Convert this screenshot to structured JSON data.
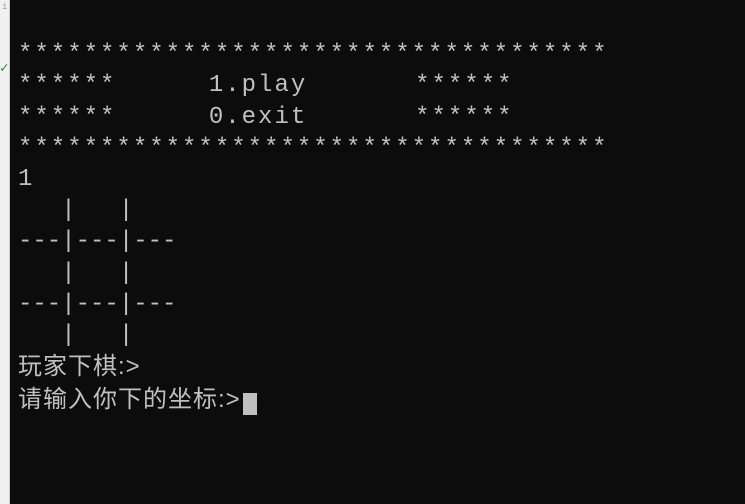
{
  "menu": {
    "border_top": "************************************",
    "border_bottom": "************************************",
    "side": "******",
    "option1": "1.play",
    "option2": "0.exit"
  },
  "user_input": "1",
  "board": {
    "row_blank": "   |   |   ",
    "row_divider": "---|---|---"
  },
  "prompts": {
    "player_move": "玩家下棋:>",
    "enter_coord": "请输入你下的坐标:>"
  }
}
